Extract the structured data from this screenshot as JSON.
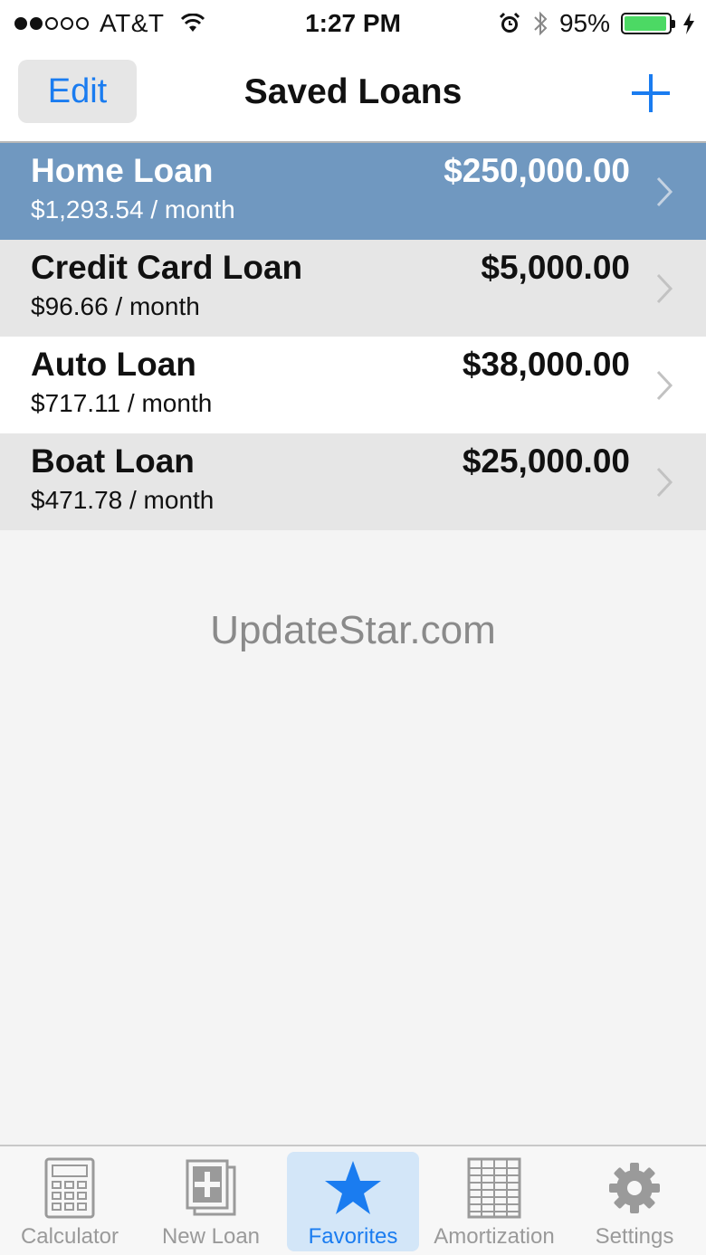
{
  "status_bar": {
    "carrier": "AT&T",
    "time": "1:27 PM",
    "battery_percent": "95%",
    "signal_icon": "signal-dots-icon",
    "wifi_icon": "wifi-icon",
    "alarm_icon": "alarm-icon",
    "bluetooth_icon": "bluetooth-icon",
    "charging_icon": "charging-bolt-icon",
    "battery_level": 0.95
  },
  "nav": {
    "edit_label": "Edit",
    "title": "Saved Loans",
    "add_icon": "plus-icon"
  },
  "loans": [
    {
      "name": "Home Loan",
      "amount": "$250,000.00",
      "monthly": "$1,293.54 / month",
      "selected": true
    },
    {
      "name": "Credit Card Loan",
      "amount": "$5,000.00",
      "monthly": "$96.66 / month",
      "selected": false
    },
    {
      "name": "Auto Loan",
      "amount": "$38,000.00",
      "monthly": "$717.11 / month",
      "selected": false
    },
    {
      "name": "Boat Loan",
      "amount": "$25,000.00",
      "monthly": "$471.78 / month",
      "selected": false
    }
  ],
  "watermark": "UpdateStar.com",
  "tabs": [
    {
      "label": "Calculator",
      "icon": "calculator-icon",
      "active": false
    },
    {
      "label": "New Loan",
      "icon": "new-loan-icon",
      "active": false
    },
    {
      "label": "Favorites",
      "icon": "star-icon",
      "active": true
    },
    {
      "label": "Amortization",
      "icon": "table-grid-icon",
      "active": false
    },
    {
      "label": "Settings",
      "icon": "gear-icon",
      "active": false
    }
  ],
  "colors": {
    "accent": "#1a7cf0",
    "selected_row": "#7098c0",
    "alt_row": "#e6e6e6",
    "battery_fill": "#4cd964",
    "active_tab_bg": "#d3e6f8"
  }
}
